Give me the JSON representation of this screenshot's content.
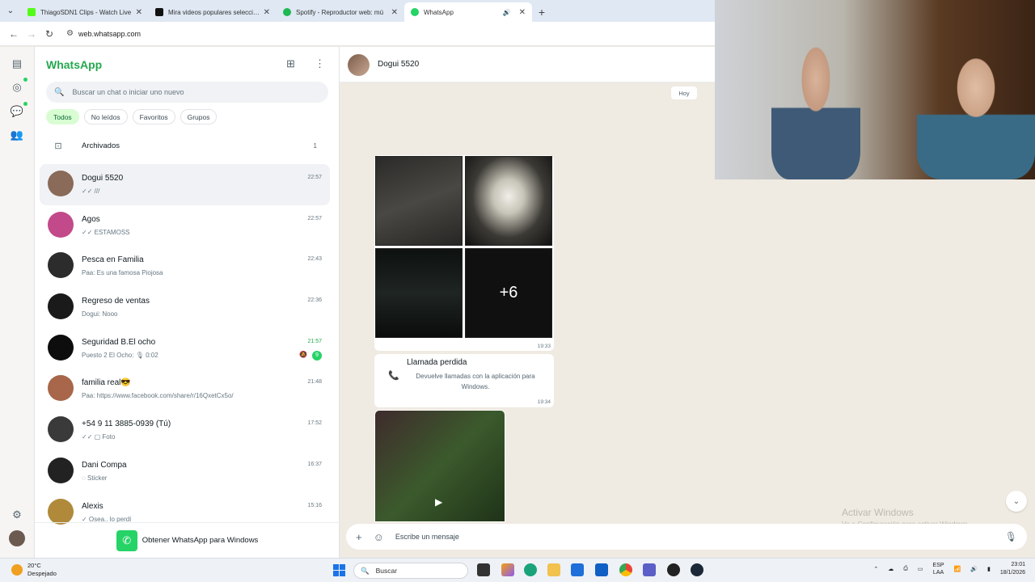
{
  "browser": {
    "tabs": [
      {
        "title": "ThiagoSDN1 Clips - Watch Live",
        "color": "#0a0a0a",
        "active": false
      },
      {
        "title": "Mira videos populares seleccion",
        "color": "#111111",
        "active": false
      },
      {
        "title": "Spotify - Reproductor web: mú",
        "color": "#1db954",
        "active": false
      },
      {
        "title": "WhatsApp",
        "color": "#25d366",
        "active": true
      }
    ],
    "url": "web.whatsapp.com"
  },
  "sidebar": {
    "title": "WhatsApp",
    "search_placeholder": "Buscar un chat o iniciar uno nuevo",
    "filters": [
      "Todos",
      "No leídos",
      "Favoritos",
      "Grupos"
    ],
    "archived_label": "Archivados",
    "archived_count": "1",
    "chats": [
      {
        "name": "Dogui 5520",
        "preview": "✓✓ ///",
        "time": "22:57",
        "color": "#8a6a58"
      },
      {
        "name": "Agos",
        "preview": "✓✓ ESTAMOSS",
        "time": "22:57",
        "color": "#c24a8a"
      },
      {
        "name": "Pesca en Familia",
        "preview": "Paa: Es una famosa Piojosa",
        "time": "22:43",
        "color": "#2c2c2c"
      },
      {
        "name": "Regreso de ventas",
        "preview": "Dogui: Nooo",
        "time": "22:36",
        "color": "#1a1a1a"
      },
      {
        "name": "Seguridad B.El ocho",
        "preview": "Puesto 2 El Ocho: 🎙 0:02",
        "time": "21:57",
        "color": "#0d0d0d",
        "badge": "9"
      },
      {
        "name": "familia real😎",
        "preview": "Paa: https://www.facebook.com/share/r/16QxetCx5o/",
        "time": "21:48",
        "color": "#a8664a"
      },
      {
        "name": "+54 9 11 3885-0939 (Tú)",
        "preview": "✓✓ ▢ Foto",
        "time": "17:52",
        "color": "#3a3a3a"
      },
      {
        "name": "Dani Compa",
        "preview": "◌ Sticker",
        "time": "16:37",
        "color": "#222222"
      },
      {
        "name": "Alexis",
        "preview": "✓ Osea.. lo perdí",
        "time": "15:16",
        "color": "#b08a3a"
      }
    ],
    "get_app_label": "Obtener WhatsApp para Windows"
  },
  "conversation": {
    "contact_name": "Dogui 5520",
    "day_chip": "Hoy",
    "album_more": "+6",
    "album_time": "19:33",
    "missed_call_title": "Llamada perdida",
    "missed_call_body": "Devuelve llamadas con la aplicación para Windows.",
    "missed_call_time": "19:34",
    "composer_placeholder": "Escribe un mensaje"
  },
  "watermark": {
    "line1": "Activar Windows",
    "line2": "Ve a Configuración para activar Windows."
  },
  "taskbar": {
    "weather_temp": "20°C",
    "weather_desc": "Despejado",
    "search_label": "Buscar",
    "lang_top": "ESP",
    "lang_bottom": "LAA",
    "time": "23:01",
    "date": "18/1/2026"
  }
}
